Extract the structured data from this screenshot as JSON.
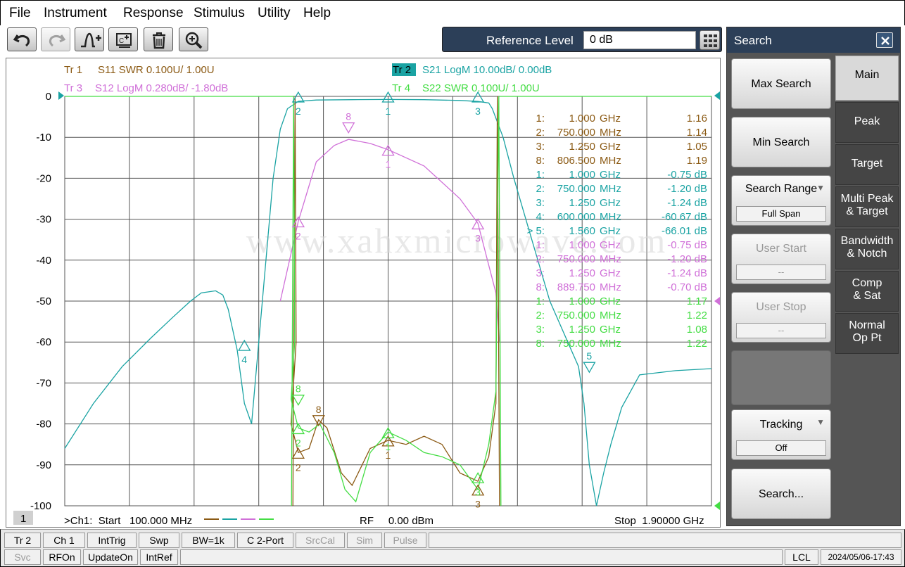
{
  "menu": [
    "File",
    "Instrument",
    "Response",
    "Stimulus",
    "Utility",
    "Help"
  ],
  "toolbar": {
    "buttons": [
      "undo-icon",
      "redo-icon",
      "marker-add-icon",
      "clear-icon",
      "trash-icon",
      "zoom-icon"
    ],
    "reference_level_label": "Reference Level",
    "reference_level_value": "0 dB"
  },
  "chart": {
    "traces": [
      {
        "label": "Tr  1",
        "desc": "S11 SWR 0.100U/  1.00U",
        "color": "#8b5a14"
      },
      {
        "label": "Tr  2",
        "desc": "S21 LogM 10.00dB/  0.00dB",
        "color": "#1aa3a3"
      },
      {
        "label": "Tr  3",
        "desc": "S12 LogM 0.280dB/  -1.80dB",
        "color": "#d070d8"
      },
      {
        "label": "Tr  4",
        "desc": "S22 SWR 0.100U/  1.00U",
        "color": "#44dd44"
      }
    ],
    "y_ticks": [
      "0",
      "-10",
      "-20",
      "-30",
      "-40",
      "-50",
      "-60",
      "-70",
      "-80",
      "-90",
      "-100"
    ],
    "channel_number": "1",
    "start_label": ">Ch1:  Start   100.000 MHz",
    "rf_label": "RF     0.00 dBm",
    "stop_label": "Stop  1.90000 GHz",
    "watermark": "www.xahxmicrowave.com"
  },
  "chart_data": {
    "type": "line",
    "x_range_mhz": [
      100,
      1900
    ],
    "ylim": [
      -100,
      0
    ],
    "grid": true,
    "series": [
      {
        "name": "S21",
        "unit": "dB",
        "x_mhz": [
          100,
          180,
          260,
          340,
          400,
          450,
          480,
          520,
          540,
          555,
          565,
          580,
          600,
          620,
          640,
          660,
          680,
          700,
          720,
          750,
          800,
          900,
          1000,
          1100,
          1200,
          1250,
          1280,
          1290,
          1320,
          1350,
          1400,
          1450,
          1500,
          1530,
          1545,
          1560,
          1580,
          1600,
          1620,
          1650,
          1700,
          1800,
          1900
        ],
        "db": [
          -86,
          -75,
          -66,
          -59,
          -54,
          -50,
          -48,
          -47.5,
          -48.5,
          -52,
          -56,
          -62,
          -75,
          -80,
          -60,
          -40,
          -20,
          -8,
          -3,
          -1.2,
          -0.9,
          -0.8,
          -0.75,
          -0.8,
          -1.0,
          -1.24,
          -1.6,
          -3,
          -10,
          -20,
          -35,
          -50,
          -60,
          -66,
          -75,
          -90,
          -100,
          -92,
          -85,
          -76,
          -68,
          -67,
          -66.5
        ]
      },
      {
        "name": "S12",
        "unit": "dB",
        "x_mhz": [
          700,
          750,
          800,
          850,
          890,
          950,
          1000,
          1100,
          1200,
          1250,
          1300,
          1310
        ],
        "db": [
          -50,
          -30.5,
          -16,
          -12,
          -10.5,
          -11.5,
          -13,
          -17,
          -25,
          -31,
          -48,
          -60
        ]
      },
      {
        "name": "S11",
        "unit": "dB",
        "x_mhz": [
          730,
          750,
          780,
          806.5,
          830,
          870,
          900,
          950,
          1000,
          1050,
          1100,
          1150,
          1200,
          1250,
          1280,
          1300
        ],
        "db": [
          -80,
          -87,
          -86,
          -79,
          -81,
          -92,
          -95,
          -86,
          -84,
          -85,
          -83,
          -85,
          -92,
          -94,
          -88,
          -75
        ]
      },
      {
        "name": "S22",
        "unit": "dB",
        "x_mhz": [
          730,
          750,
          780,
          810,
          850,
          880,
          910,
          950,
          1000,
          1050,
          1100,
          1150,
          1200,
          1250,
          1280,
          1300
        ],
        "db": [
          -74,
          -81,
          -82,
          -80,
          -87,
          -96,
          -99,
          -87,
          -82,
          -84,
          -87,
          -88,
          -90,
          -96,
          -85,
          -72
        ]
      }
    ]
  },
  "markers": [
    {
      "label": "1:",
      "value": "1.000",
      "unit": "GHz",
      "reading": "1.16",
      "color": "#8b5a14"
    },
    {
      "label": "2:",
      "value": "750.000",
      "unit": "MHz",
      "reading": "1.14",
      "color": "#8b5a14"
    },
    {
      "label": "3:",
      "value": "1.250",
      "unit": "GHz",
      "reading": "1.05",
      "color": "#8b5a14"
    },
    {
      "label": "8:",
      "value": "806.500",
      "unit": "MHz",
      "reading": "1.19",
      "color": "#8b5a14"
    },
    {
      "label": "1:",
      "value": "1.000",
      "unit": "GHz",
      "reading": "-0.75 dB",
      "color": "#1aa3a3"
    },
    {
      "label": "2:",
      "value": "750.000",
      "unit": "MHz",
      "reading": "-1.20 dB",
      "color": "#1aa3a3"
    },
    {
      "label": "3:",
      "value": "1.250",
      "unit": "GHz",
      "reading": "-1.24 dB",
      "color": "#1aa3a3"
    },
    {
      "label": "4:",
      "value": "600.000",
      "unit": "MHz",
      "reading": "-60.67 dB",
      "color": "#1aa3a3"
    },
    {
      "label": "> 5:",
      "value": "1.560",
      "unit": "GHz",
      "reading": "-66.01 dB",
      "color": "#1aa3a3"
    },
    {
      "label": "1:",
      "value": "1.000",
      "unit": "GHz",
      "reading": "-0.75 dB",
      "color": "#d070d8"
    },
    {
      "label": "2:",
      "value": "750.000",
      "unit": "MHz",
      "reading": "-1.20 dB",
      "color": "#d070d8"
    },
    {
      "label": "3:",
      "value": "1.250",
      "unit": "GHz",
      "reading": "-1.24 dB",
      "color": "#d070d8"
    },
    {
      "label": "8:",
      "value": "889.750",
      "unit": "MHz",
      "reading": "-0.70 dB",
      "color": "#d070d8"
    },
    {
      "label": "1:",
      "value": "1.000",
      "unit": "GHz",
      "reading": "1.17",
      "color": "#44dd44"
    },
    {
      "label": "2:",
      "value": "750.000",
      "unit": "MHz",
      "reading": "1.22",
      "color": "#44dd44"
    },
    {
      "label": "3:",
      "value": "1.250",
      "unit": "GHz",
      "reading": "1.08",
      "color": "#44dd44"
    },
    {
      "label": "8:",
      "value": "750.000",
      "unit": "MHz",
      "reading": "1.22",
      "color": "#44dd44"
    }
  ],
  "marker_tags": [
    {
      "text": "2",
      "mhz": 750,
      "db": 0,
      "color": "#1aa3a3",
      "dir": "up"
    },
    {
      "text": "1",
      "mhz": 1000,
      "db": 0,
      "color": "#1aa3a3",
      "dir": "up"
    },
    {
      "text": "3",
      "mhz": 1250,
      "db": 0,
      "color": "#1aa3a3",
      "dir": "up"
    },
    {
      "text": "4",
      "mhz": 600,
      "db": -60.67,
      "color": "#1aa3a3",
      "dir": "up"
    },
    {
      "text": "5",
      "mhz": 1560,
      "db": -66.01,
      "color": "#1aa3a3",
      "dir": "down"
    },
    {
      "text": "8",
      "mhz": 889.75,
      "db": -7.5,
      "color": "#d070d8",
      "dir": "down"
    },
    {
      "text": "1",
      "mhz": 1000,
      "db": -13,
      "color": "#d070d8",
      "dir": "up"
    },
    {
      "text": "2",
      "mhz": 750,
      "db": -30.5,
      "color": "#d070d8",
      "dir": "up"
    },
    {
      "text": "3",
      "mhz": 1250,
      "db": -31,
      "color": "#d070d8",
      "dir": "up"
    },
    {
      "text": "8",
      "mhz": 806.5,
      "db": -79,
      "color": "#8b5a14",
      "dir": "down"
    },
    {
      "text": "2",
      "mhz": 750,
      "db": -87,
      "color": "#8b5a14",
      "dir": "up"
    },
    {
      "text": "1",
      "mhz": 1000,
      "db": -84,
      "color": "#8b5a14",
      "dir": "up"
    },
    {
      "text": "3",
      "mhz": 1250,
      "db": -96,
      "color": "#8b5a14",
      "dir": "up"
    },
    {
      "text": "8",
      "mhz": 750,
      "db": -74,
      "color": "#44dd44",
      "dir": "down"
    },
    {
      "text": "2",
      "mhz": 750,
      "db": -81,
      "color": "#44dd44",
      "dir": "up"
    },
    {
      "text": "1",
      "mhz": 1000,
      "db": -82,
      "color": "#44dd44",
      "dir": "up"
    },
    {
      "text": "3",
      "mhz": 1250,
      "db": -93,
      "color": "#44dd44",
      "dir": "up"
    }
  ],
  "search_panel": {
    "title": "Search",
    "buttons": {
      "max_search": "Max Search",
      "min_search": "Min Search",
      "search_range": "Search Range",
      "search_range_value": "Full Span",
      "user_start": "User Start",
      "user_start_value": "--",
      "user_stop": "User Stop",
      "user_stop_value": "--",
      "tracking": "Tracking",
      "tracking_value": "Off",
      "search_dialog": "Search..."
    },
    "tabs": [
      [
        "Main"
      ],
      [
        "Peak"
      ],
      [
        "Target"
      ],
      [
        "Multi Peak",
        "& Target"
      ],
      [
        "Bandwidth",
        "& Notch"
      ],
      [
        "Comp",
        "& Sat"
      ],
      [
        "Normal",
        "Op Pt"
      ]
    ]
  },
  "status_row1": [
    "Tr 2",
    "Ch 1",
    "IntTrig",
    "Swp",
    "BW=1k",
    "C  2-Port",
    "SrcCal",
    "Sim",
    "Pulse"
  ],
  "status_row2": [
    "Svc",
    "RFOn",
    "UpdateOn",
    "IntRef"
  ],
  "status_right": {
    "mode": "LCL",
    "datetime": "2024/05/06-17:43"
  }
}
